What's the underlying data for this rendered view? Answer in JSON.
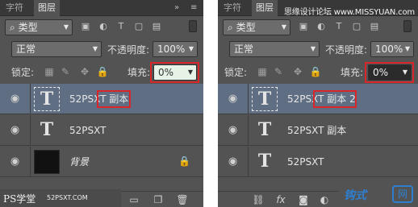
{
  "left": {
    "tabs": [
      {
        "label": "字符"
      },
      {
        "label": "图层"
      }
    ],
    "tab_close": "×",
    "menu_icon": "»",
    "menu_list_icon": "≡",
    "filter": {
      "label": "类型",
      "search_icon": "⌕"
    },
    "filter_icons": [
      "image-filter-icon",
      "adjustment-filter-icon",
      "type-filter-icon",
      "shape-filter-icon",
      "smart-object-filter-icon"
    ],
    "blend_mode": "正常",
    "opacity_label": "不透明度:",
    "opacity_value": "100%",
    "lock_label": "锁定:",
    "fill_label": "填充:",
    "fill_value": "0%",
    "layers": [
      {
        "name": "52PSXT",
        "suffix": "副本",
        "thumb": "T",
        "selected": true
      },
      {
        "name": "52PSXT",
        "thumb": "T",
        "selected": false
      },
      {
        "name": "背景",
        "thumb": "",
        "selected": false,
        "locked": true
      }
    ],
    "watermark": {
      "brand": "PS学堂",
      "url": "52PSXT.COM"
    }
  },
  "right": {
    "tabs": [
      {
        "label": "字符"
      },
      {
        "label": "图层"
      }
    ],
    "filter": {
      "label": "类型"
    },
    "blend_mode": "正常",
    "opacity_label": "不透明度:",
    "opacity_value": "100%",
    "lock_label": "锁定:",
    "fill_label": "填充:",
    "fill_value": "0%",
    "layers": [
      {
        "name": "52PSXT",
        "suffix": "副本 2",
        "thumb": "T",
        "selected": true
      },
      {
        "name": "52PSXT",
        "suffix": "副本",
        "thumb": "T",
        "selected": false
      },
      {
        "name": "52PSXT",
        "thumb": "T",
        "selected": false
      }
    ],
    "bottom_icons": [
      "link-icon",
      "fx-icon",
      "mask-icon",
      "adjustment-icon",
      "group-icon",
      "new-layer-icon",
      "delete-icon"
    ],
    "watermark": {
      "top": "思缘设计论坛 www.MISSYUAN.com",
      "logo": "钩式",
      "logo2": "网"
    }
  },
  "colors": {
    "highlight": "#d8262b",
    "panel": "#535353",
    "selected_row": "#5f6e82",
    "brand_blue": "#2f7fd1"
  }
}
